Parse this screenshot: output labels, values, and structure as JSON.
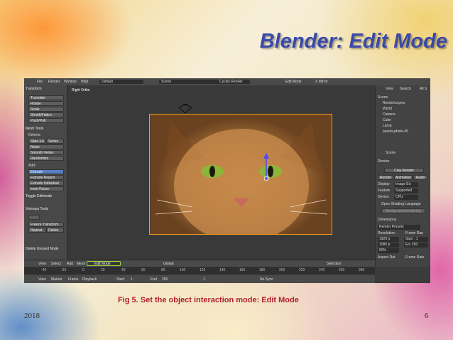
{
  "slide": {
    "title": "Blender: Edit Mode",
    "caption": "Fig 5. Set the object interaction mode: Edit Mode",
    "year": "2018",
    "page_number": "6"
  },
  "topbar": {
    "menus": [
      "File",
      "Render",
      "Window",
      "Help"
    ],
    "layout": "Default",
    "scene": "Scene",
    "engine": "Cycles Render",
    "mode_label": "Edit Mode",
    "mirror": "X Mirror"
  },
  "tool_shelf": {
    "transform_header": "Transform",
    "transform_buttons": [
      "Translate",
      "Rotate",
      "Scale",
      "Shrink/Fatten",
      "Push/Pull"
    ],
    "mesh_tools_header": "Mesh Tools",
    "deform_label": "Deform:",
    "deform_buttons": [
      "Slide Ed",
      "Vertex"
    ],
    "mesh_buttons": [
      "Noise",
      "Smooth Vertex",
      "Randomize"
    ],
    "add_label": "Add:",
    "add_buttons": [
      "Extrude",
      "Extrude Region",
      "Extrude Individual",
      "Inset Faces"
    ],
    "toggle_editmode": "Toggle Editmode",
    "vismaya_header": "Vismaya Tools",
    "freeze_button": "Freeze Transform",
    "repeat_button": "Repeat",
    "delete_button": "Delete",
    "delete_unused": "Delete Unused Node"
  },
  "viewport": {
    "label": "Right Ortho"
  },
  "outliner": {
    "view_label": "View",
    "search_label": "Search",
    "all_label": "All S",
    "items": [
      "Scene",
      "RenderLayers",
      "World",
      "Camera",
      "Cube",
      "Lamp",
      "pexels-photo-45"
    ]
  },
  "properties": {
    "scene_label": "Scene",
    "render_header": "Render",
    "clay_render": "Clay Render",
    "render_button": "Render",
    "animation_button": "Animation",
    "audio_button": "Audio",
    "display_label": "Display:",
    "display_value": "Image Ed",
    "feature_label": "Feature",
    "feature_value": "Supported",
    "device_label": "Device:",
    "device_value": "CPU",
    "osl_label": "Open Shading Language",
    "bg_render": "Background rendering",
    "dimensions_header": "Dimensions",
    "render_presets": "Render Presets",
    "resolution_label": "Resolution:",
    "res_x": "1920 p",
    "res_y": "1080 p",
    "res_pct": "50%",
    "frame_range_label": "Frame Ran",
    "start": "Start : 1",
    "end": "En: 250",
    "aspect_label": "Aspect Rat",
    "frame_rate_label": "Frame Rate"
  },
  "header3d": {
    "view": "View",
    "select": "Select",
    "add": "Add",
    "mesh": "Mesh",
    "mode": "Edit Mode",
    "orientation": "Global",
    "selection": "Selection"
  },
  "ruler": {
    "ticks": [
      "-40",
      "-20",
      "0",
      "20",
      "40",
      "60",
      "80",
      "100",
      "120",
      "140",
      "160",
      "180",
      "200",
      "220",
      "240",
      "260",
      "280"
    ]
  },
  "timeline": {
    "view": "View",
    "marker": "Marker",
    "frame": "Frame",
    "playback": "Playback",
    "start": "Start:",
    "start_val": "1",
    "end": "End",
    "end_val": "250",
    "current": "1",
    "sync": "No Sync"
  },
  "colors": {
    "title": "#3a49a8",
    "caption": "#b21f2d",
    "highlight": "#9fe03a",
    "active_button": "#5680c2",
    "photo_border": "#f39a1a"
  }
}
